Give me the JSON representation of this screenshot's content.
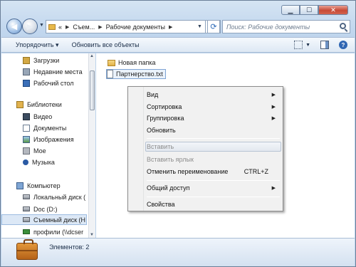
{
  "window": {
    "buttons": {
      "minimize": "▁",
      "maximize": "☐",
      "close": "✕"
    }
  },
  "navigation": {
    "back_icon": "arrow-left-icon",
    "forward_icon": "arrow-right-icon",
    "address": {
      "prefix": "«",
      "segments": [
        "Съем...",
        "Рабочие документы"
      ]
    },
    "search_placeholder": "Поиск: Рабочие документы"
  },
  "toolbar": {
    "organize_label": "Упорядочить ▾",
    "burn_label": "Обновить все объекты"
  },
  "sidebar": {
    "favorites": [
      {
        "label": "Загрузки",
        "icon": "downloads-icon"
      },
      {
        "label": "Недавние места",
        "icon": "recent-places-icon"
      },
      {
        "label": "Рабочий стол",
        "icon": "desktop-icon"
      }
    ],
    "libraries_label": "Библиотеки",
    "libraries": [
      {
        "label": "Видео",
        "icon": "video-icon"
      },
      {
        "label": "Документы",
        "icon": "documents-icon"
      },
      {
        "label": "Изображения",
        "icon": "pictures-icon"
      },
      {
        "label": "Мое",
        "icon": "mine-icon"
      },
      {
        "label": "Музыка",
        "icon": "music-icon"
      }
    ],
    "computer_label": "Компьютер",
    "drives": [
      {
        "label": "Локальный диск (",
        "icon": "local-disk-icon"
      },
      {
        "label": "Doc (D:)",
        "icon": "disk-icon"
      },
      {
        "label": "Съемный диск (H",
        "icon": "removable-disk-icon",
        "selected": true
      },
      {
        "label": "профили (\\\\dcser",
        "icon": "network-drive-icon"
      }
    ]
  },
  "files": [
    {
      "label": "Новая папка",
      "icon": "folder-icon"
    },
    {
      "label": "Партнерство.txt",
      "icon": "text-file-icon",
      "renaming": true
    }
  ],
  "context_menu": {
    "items": [
      {
        "label": "Вид",
        "submenu": true
      },
      {
        "label": "Сортировка",
        "submenu": true
      },
      {
        "label": "Группировка",
        "submenu": true
      },
      {
        "label": "Обновить"
      },
      {
        "label": "Вставить",
        "disabled": true,
        "highlighted": true
      },
      {
        "label": "Вставить ярлык",
        "disabled": true
      },
      {
        "label": "Отменить переименование",
        "shortcut": "CTRL+Z"
      },
      {
        "label": "Общий доступ",
        "submenu": true
      },
      {
        "label": "Свойства"
      }
    ]
  },
  "details": {
    "item_count": "Элементов: 2",
    "icon": "briefcase-icon"
  }
}
